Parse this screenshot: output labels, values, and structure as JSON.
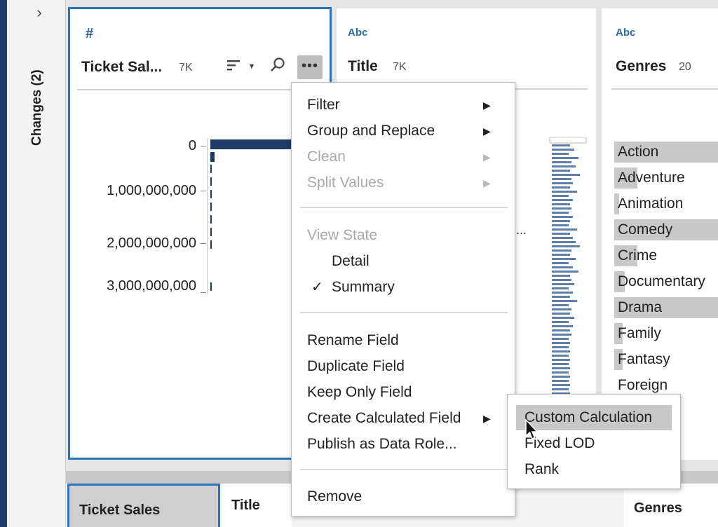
{
  "rail": {
    "label": "Changes (2)",
    "expand_icon": "chevron-right-icon"
  },
  "fields": [
    {
      "type_icon": "#",
      "name": "Ticket Sal...",
      "count": "7K"
    },
    {
      "type_icon": "Abc",
      "name": "Title",
      "count": "7K"
    },
    {
      "type_icon": "Abc",
      "name": "Genres",
      "count": "20"
    }
  ],
  "ticket_card": {
    "axis_labels": [
      "0",
      "1,000,000,000",
      "2,000,000,000",
      "3,000,000,000"
    ]
  },
  "title_card": {
    "truncated_value": "..."
  },
  "genres": [
    {
      "label": "Action",
      "fill": 1.0
    },
    {
      "label": "Adventure",
      "fill": 0.22
    },
    {
      "label": "Animation",
      "fill": 0.05
    },
    {
      "label": "Comedy",
      "fill": 1.0
    },
    {
      "label": "Crime",
      "fill": 0.22
    },
    {
      "label": "Documentary",
      "fill": 0.1
    },
    {
      "label": "Drama",
      "fill": 1.0
    },
    {
      "label": "Family",
      "fill": 0.08
    },
    {
      "label": "Fantasy",
      "fill": 0.08
    },
    {
      "label": "Foreign",
      "fill": 0.0
    }
  ],
  "context_menu": {
    "group1": [
      {
        "label": "Filter",
        "enabled": true,
        "submenu": true
      },
      {
        "label": "Group and Replace",
        "enabled": true,
        "submenu": true
      },
      {
        "label": "Clean",
        "enabled": false,
        "submenu": true
      },
      {
        "label": "Split Values",
        "enabled": false,
        "submenu": true
      }
    ],
    "view_state": {
      "heading": "View State",
      "options": [
        {
          "label": "Detail",
          "checked": false
        },
        {
          "label": "Summary",
          "checked": true
        }
      ]
    },
    "group3": [
      {
        "label": "Rename Field"
      },
      {
        "label": "Duplicate Field"
      },
      {
        "label": "Keep Only Field"
      },
      {
        "label": "Create Calculated Field",
        "submenu": true
      },
      {
        "label": "Publish as Data Role..."
      }
    ],
    "remove": "Remove"
  },
  "calc_submenu": {
    "items": [
      {
        "label": "Custom Calculation",
        "hovered": true
      },
      {
        "label": "Fixed LOD",
        "hovered": false
      },
      {
        "label": "Rank",
        "hovered": false
      }
    ]
  },
  "bottom_tabs": [
    "Ticket Sales",
    "Title",
    "Genres"
  ]
}
